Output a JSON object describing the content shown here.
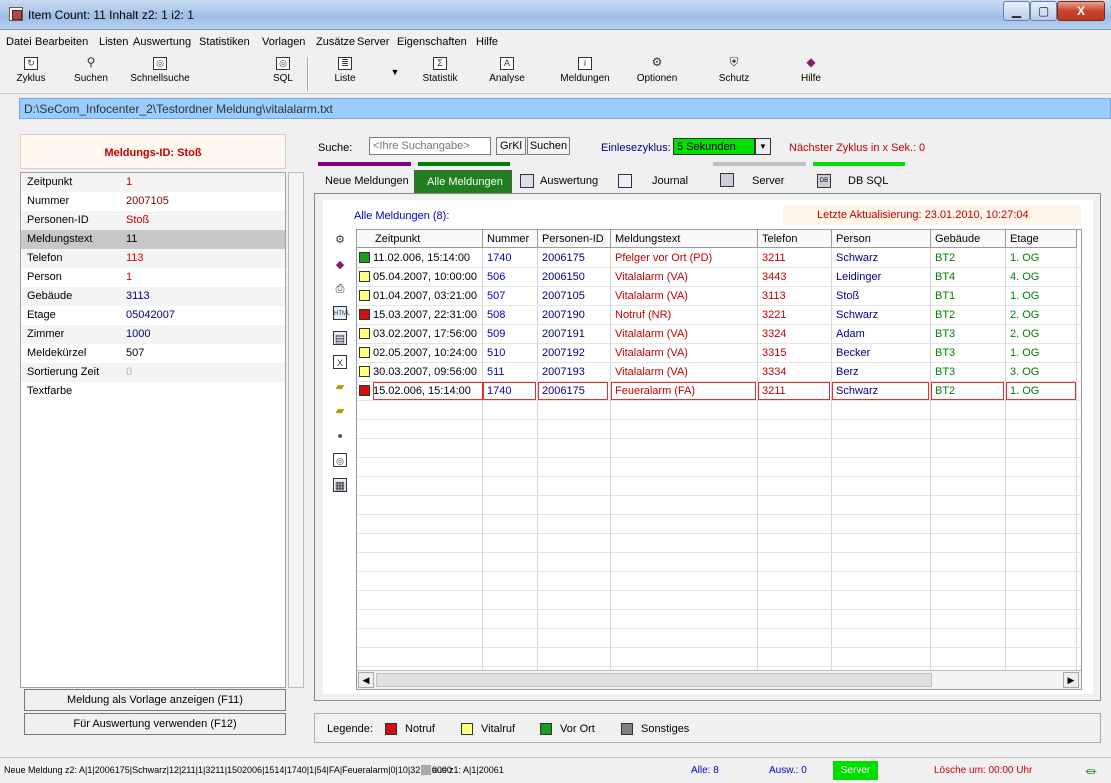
{
  "window": {
    "title": "Item Count: 11  Inhalt z2: 1  i2: 1",
    "min": "▁",
    "max": "▢",
    "close": "X"
  },
  "menu": [
    "Datei",
    "Bearbeiten",
    "Listen",
    "Auswertung",
    "Statistiken",
    "Vorlagen",
    "Zusätze",
    "Server",
    "Eigenschaften",
    "Hilfe"
  ],
  "toolbar": {
    "zyklus": "Zyklus",
    "suchen": "Suchen",
    "schnellsuche": "Schnellsuche",
    "sql": "SQL",
    "liste": "Liste",
    "statistik": "Statistik",
    "analyse": "Analyse",
    "meldungen": "Meldungen",
    "optionen": "Optionen",
    "schutz": "Schutz",
    "hilfe": "Hilfe"
  },
  "path": "D:\\SeCom_Infocenter_2\\Testordner Meldung\\vitalalarm.txt",
  "left": {
    "id_label": "Meldungs-ID: Stoß",
    "fields": [
      {
        "label": "Zeitpunkt",
        "value": "1",
        "color": "#c00000"
      },
      {
        "label": "Nummer",
        "value": "2007105",
        "color": "#800000"
      },
      {
        "label": "Personen-ID",
        "value": "Stoß",
        "color": "#c00000"
      },
      {
        "label": "Meldungstext",
        "value": "11",
        "color": "#000000"
      },
      {
        "label": "Telefon",
        "value": "113",
        "color": "#e00000"
      },
      {
        "label": "Person",
        "value": "1",
        "color": "#e00000"
      },
      {
        "label": "Gebäude",
        "value": "3113",
        "color": "#000080"
      },
      {
        "label": "Etage",
        "value": "05042007",
        "color": "#000080"
      },
      {
        "label": "Zimmer",
        "value": "1000",
        "color": "#000080"
      },
      {
        "label": "Meldekürzel",
        "value": "507",
        "color": "#000000"
      },
      {
        "label": "Sortierung Zeit",
        "value": "0",
        "color": "#b0b0b0"
      },
      {
        "label": "Textfarbe",
        "value": "",
        "color": "#000000"
      }
    ],
    "btn_vorlage": "Meldung als Vorlage anzeigen (F11)",
    "btn_auswertung": "Für Auswertung verwenden (F12)"
  },
  "search": {
    "label": "Suche:",
    "placeholder": "<Ihre Suchangabe>",
    "grkl": "GrKl",
    "suchen": "Suchen",
    "zyklus_label": "Einlesezyklus:",
    "zyklus_value": "5 Sekunden",
    "next_label": "Nächster Zyklus in x Sek.:",
    "next_value": "0"
  },
  "tabs": [
    "Neue Meldungen",
    "Alle Meldungen",
    "Auswertung",
    "Journal",
    "Server",
    "DB SQL"
  ],
  "list": {
    "caption": "Alle Meldungen (8):",
    "last_update": "Letzte Aktualisierung: 23.01.2010, 10:27:04",
    "headers": [
      "Zeitpunkt",
      "Nummer",
      "Personen-ID",
      "Meldungstext",
      "Telefon",
      "Person",
      "Gebäude",
      "Etage"
    ],
    "rows": [
      {
        "status": "Vor Ort",
        "box": "#1c9c1c",
        "cells": [
          "11.02.006, 15:14:00",
          "1740",
          "2006175",
          "Pfelger vor Ort (PD)",
          "3211",
          "Schwarz",
          "BT2",
          "1. OG"
        ],
        "text_color": "#c00000"
      },
      {
        "status": "Vitalruf",
        "box": "#ffff80",
        "cells": [
          "05.04.2007, 10:00:00",
          "506",
          "2006150",
          "Vitalalarm (VA)",
          "3443",
          "Leidinger",
          "BT4",
          "4. OG"
        ],
        "text_color": "#c00000"
      },
      {
        "status": "Vitalruf",
        "box": "#ffff80",
        "cells": [
          "01.04.2007, 03:21:00",
          "507",
          "2007105",
          "Vitalalarm (VA)",
          "3113",
          "Stoß",
          "BT1",
          "1. OG"
        ],
        "text_color": "#c00000"
      },
      {
        "status": "Notruf",
        "box": "#d01010",
        "cells": [
          "15.03.2007, 22:31:00",
          "508",
          "2007190",
          "Notruf (NR)",
          "3221",
          "Schwarz",
          "BT2",
          "2. OG"
        ],
        "text_color": "#c00000"
      },
      {
        "status": "Vitalruf",
        "box": "#ffff80",
        "cells": [
          "03.02.2007, 17:56:00",
          "509",
          "2007191",
          "Vitalalarm (VA)",
          "3324",
          "Adam",
          "BT3",
          "2. OG"
        ],
        "text_color": "#c00000"
      },
      {
        "status": "Vitalruf",
        "box": "#ffff80",
        "cells": [
          "02.05.2007, 10:24:00",
          "510",
          "2007192",
          "Vitalalarm (VA)",
          "3315",
          "Becker",
          "BT3",
          "1. OG"
        ],
        "text_color": "#c00000"
      },
      {
        "status": "Vitalruf",
        "box": "#ffff80",
        "cells": [
          "30.03.2007, 09:56:00",
          "511",
          "2007193",
          "Vitalalarm (VA)",
          "3334",
          "Berz",
          "BT3",
          "3. OG"
        ],
        "text_color": "#c00000"
      },
      {
        "status": "Notruf",
        "box": "#d01010",
        "cells": [
          "15.02.006, 15:14:00",
          "1740",
          "2006175",
          "Feueralarm (FA)",
          "3211",
          "Schwarz",
          "BT2",
          "1. OG"
        ],
        "text_color": "#c00000"
      }
    ]
  },
  "legend": {
    "label": "Legende:",
    "items": [
      {
        "label": "Notruf",
        "color": "#d01010"
      },
      {
        "label": "Vitalruf",
        "color": "#ffff80"
      },
      {
        "label": "Vor Ort",
        "color": "#1c9c1c"
      },
      {
        "label": "Sonstiges",
        "color": "#808080"
      }
    ]
  },
  "status": {
    "text": "Neue Meldung z2: A|1|2006175|Schwarz|12|211|1|3211|1502006|1514|1740|1|54|FA|Feueralarm|0|10|3211|0000",
    "text2": "aus z1: A|1|20061",
    "alle": "Alle: 8",
    "ausw": "Ausw.: 0",
    "server": "Server",
    "loesche": "Lösche um: 00:00 Uhr"
  }
}
